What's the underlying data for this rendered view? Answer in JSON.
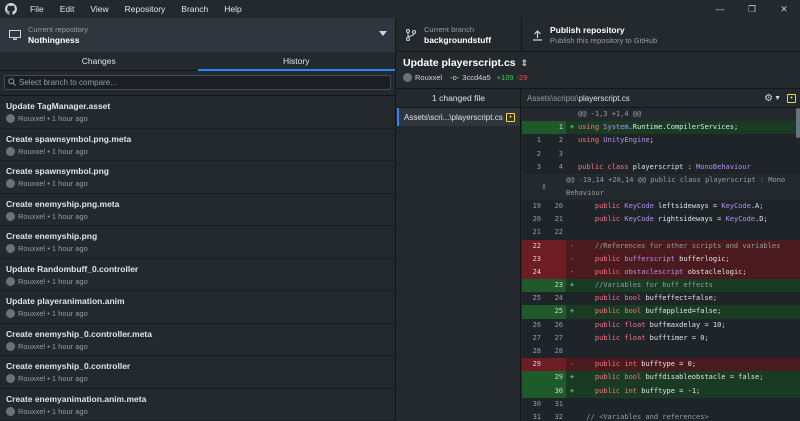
{
  "menu": [
    "File",
    "Edit",
    "View",
    "Repository",
    "Branch",
    "Help"
  ],
  "toolbar": {
    "repo_label": "Current repository",
    "repo_name": "Nothingness",
    "branch_label": "Current branch",
    "branch_name": "backgroundstuff",
    "publish_title": "Publish repository",
    "publish_sub": "Publish this repository to GitHub"
  },
  "tabs": {
    "changes": "Changes",
    "history": "History"
  },
  "branch_filter": {
    "placeholder": "Select branch to compare..."
  },
  "commits": [
    {
      "title": "Update TagManager.asset",
      "author": "Rouxxel",
      "time": "1 hour ago"
    },
    {
      "title": "Create spawnsymbol.png.meta",
      "author": "Rouxxel",
      "time": "1 hour ago"
    },
    {
      "title": "Create spawnsymbol.png",
      "author": "Rouxxel",
      "time": "1 hour ago"
    },
    {
      "title": "Create enemyship.png.meta",
      "author": "Rouxxel",
      "time": "1 hour ago"
    },
    {
      "title": "Create enemyship.png",
      "author": "Rouxxel",
      "time": "1 hour ago"
    },
    {
      "title": "Update Randombuff_0.controller",
      "author": "Rouxxel",
      "time": "1 hour ago"
    },
    {
      "title": "Update playeranimation.anim",
      "author": "Rouxxel",
      "time": "1 hour ago"
    },
    {
      "title": "Create enemyship_0.controller.meta",
      "author": "Rouxxel",
      "time": "1 hour ago"
    },
    {
      "title": "Create enemyship_0.controller",
      "author": "Rouxxel",
      "time": "1 hour ago"
    },
    {
      "title": "Create enemyanimation.anim.meta",
      "author": "Rouxxel",
      "time": "1 hour ago"
    }
  ],
  "commit_detail": {
    "title": "Update playerscript.cs",
    "author": "Rouxxel",
    "sha": "3ccd4a5",
    "additions": "+109",
    "deletions": "-29",
    "changed_files": "1 changed file",
    "file_item": "Assets\\scri...\\playerscript.cs",
    "diff_path_dir": "Assets\\scripts\\",
    "diff_path_file": "playerscript.cs"
  },
  "diff_lines": [
    {
      "type": "hunk",
      "old": "",
      "new": "",
      "mark": "",
      "code": "@@ -1,3 +1,4 @@"
    },
    {
      "type": "add",
      "old": "",
      "new": "1",
      "mark": "+",
      "code": "using System.Runtime.CompilerServices;"
    },
    {
      "type": "ctx",
      "old": "1",
      "new": "2",
      "mark": "",
      "code": "using UnityEngine;"
    },
    {
      "type": "ctx",
      "old": "2",
      "new": "3",
      "mark": "",
      "code": ""
    },
    {
      "type": "ctx",
      "old": "3",
      "new": "4",
      "mark": "",
      "code": "public class playerscript : MonoBehaviour"
    },
    {
      "type": "expander",
      "old": "",
      "new": "",
      "mark": "",
      "code": "@@ -19,14 +20,14 @@ public class playerscript : Mono\nBehaviour"
    },
    {
      "type": "ctx",
      "old": "19",
      "new": "20",
      "mark": "",
      "code": "    public KeyCode leftsideways = KeyCode.A;"
    },
    {
      "type": "ctx",
      "old": "20",
      "new": "21",
      "mark": "",
      "code": "    public KeyCode rightsideways = KeyCode.D;"
    },
    {
      "type": "ctx",
      "old": "21",
      "new": "22",
      "mark": "",
      "code": ""
    },
    {
      "type": "del",
      "old": "22",
      "new": "",
      "mark": "-",
      "code": "    //References for other scripts and variables"
    },
    {
      "type": "del",
      "old": "23",
      "new": "",
      "mark": "-",
      "code": "    public bufferscript bufferlogic;"
    },
    {
      "type": "del",
      "old": "24",
      "new": "",
      "mark": "-",
      "code": "    public obstaclescript obstaclelogic;"
    },
    {
      "type": "add",
      "old": "",
      "new": "23",
      "mark": "+",
      "code": "    //Variables for buff effects"
    },
    {
      "type": "ctx",
      "old": "25",
      "new": "24",
      "mark": "",
      "code": "    public bool buffeffect=false;"
    },
    {
      "type": "add",
      "old": "",
      "new": "25",
      "mark": "+",
      "code": "    public bool buffapplied=false;"
    },
    {
      "type": "ctx",
      "old": "26",
      "new": "26",
      "mark": "",
      "code": "    public float buffmaxdelay = 10;"
    },
    {
      "type": "ctx",
      "old": "27",
      "new": "27",
      "mark": "",
      "code": "    public float bufftimer = 0;"
    },
    {
      "type": "ctx",
      "old": "28",
      "new": "28",
      "mark": "",
      "code": ""
    },
    {
      "type": "del",
      "old": "29",
      "new": "",
      "mark": "-",
      "code": "    public int bufftype = 0;"
    },
    {
      "type": "add",
      "old": "",
      "new": "29",
      "mark": "+",
      "code": "    public bool buffdisableobstacle = false;"
    },
    {
      "type": "add",
      "old": "",
      "new": "30",
      "mark": "+",
      "code": "    public int bufftype = -1;"
    },
    {
      "type": "ctx",
      "old": "30",
      "new": "31",
      "mark": "",
      "code": ""
    },
    {
      "type": "ctx",
      "old": "31",
      "new": "32",
      "mark": "",
      "code": "  // <Variables and references>"
    }
  ]
}
